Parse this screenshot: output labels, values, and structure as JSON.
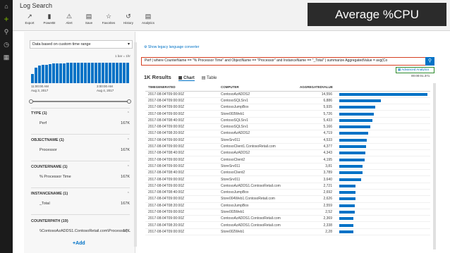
{
  "app": {
    "title": "Log Search"
  },
  "banner": {
    "text": "Average %CPU"
  },
  "leftbar": {
    "icons": [
      "home-icon",
      "plus-icon",
      "search-icon",
      "clock-icon",
      "analytics-icon"
    ]
  },
  "toolbar": {
    "items": [
      {
        "label": "Export",
        "icon": "export-icon"
      },
      {
        "label": "PowerBI",
        "icon": "powerbi-icon"
      },
      {
        "label": "Alert",
        "icon": "bell-icon"
      },
      {
        "label": "Save",
        "icon": "save-icon"
      },
      {
        "label": "Favorites",
        "icon": "star-icon"
      },
      {
        "label": "History",
        "icon": "history-icon"
      },
      {
        "label": "Analytics",
        "icon": "analytics-icon"
      }
    ]
  },
  "filters": {
    "time_range": "Data based on custom time range",
    "histogram": {
      "interval": "1 bar = 1hr",
      "values": [
        0.45,
        0.75,
        0.83,
        0.86,
        0.88,
        0.9,
        0.92,
        0.93,
        0.94,
        0.95,
        0.96,
        0.97,
        0.97,
        0.97,
        0.97,
        0.97,
        0.97,
        0.97,
        0.97,
        0.97,
        0.97,
        0.97,
        0.97,
        0.97,
        0.97,
        0.98,
        0.98,
        0.98
      ],
      "start_time": "11:00:00 AM",
      "start_date": "Aug 3, 2017",
      "end_time": "3:00:00 AM",
      "end_date": "Aug 4, 2017"
    },
    "facets": [
      {
        "header": "TYPE (1)",
        "value": "Perf",
        "count": "167K"
      },
      {
        "header": "OBJECTNAME (1)",
        "value": "Processor",
        "count": "167K"
      },
      {
        "header": "COUNTERNAME (1)",
        "value": "% Processor Time",
        "count": "167K"
      },
      {
        "header": "INSTANCENAME (1)",
        "value": "_Total",
        "count": "167K"
      },
      {
        "header": "COUNTERPATH (19)",
        "value": "\\\\ContosoAzADDS1.ContosoRetail.com\\Processor(...",
        "count": "17K"
      }
    ],
    "add_label": "+Add"
  },
  "query": {
    "legacy_link": "Show legacy language converter",
    "text": "Perf | where CounterName == \"% Processor Time\" and ObjectName == \"Processor\" and InstanceName == \"_Total\" | summarize AggregatedValue = avg(Co",
    "advanced_analytics": "Advanced Analytics"
  },
  "results": {
    "tabs": [
      {
        "label": "1K Results"
      },
      {
        "label": "Chart",
        "icon": "chart-icon"
      },
      {
        "label": "Table",
        "icon": "table-icon"
      }
    ],
    "elapsed": "00:00:01.371",
    "columns": [
      "TIMEGENERATED",
      "COMPUTER",
      "AGGREGATEDVALUE"
    ],
    "max_value": 14.556,
    "rows": [
      {
        "time": "2017-08-04T09:00:00Z",
        "computer": "ContosoAzADDS2",
        "value_text": "14,556",
        "value": 14.556
      },
      {
        "time": "2017-08-04T09:00:00Z",
        "computer": "ContosoSQLSrv1",
        "value_text": "6,886",
        "value": 6.886
      },
      {
        "time": "2017-08-04T09:00:00Z",
        "computer": "ContosoJumpBox",
        "value_text": "5,935",
        "value": 5.935
      },
      {
        "time": "2017-08-04T09:00:00Z",
        "computer": "Store003Web1",
        "value_text": "5,726",
        "value": 5.726
      },
      {
        "time": "2017-08-04T08:40:00Z",
        "computer": "ContosoSQLSrv1",
        "value_text": "5,433",
        "value": 5.433
      },
      {
        "time": "2017-08-04T09:00:00Z",
        "computer": "ContosoSQLSrv1",
        "value_text": "5,166",
        "value": 5.166
      },
      {
        "time": "2017-08-04T08:20:00Z",
        "computer": "ContosoAzADDS2",
        "value_text": "4,719",
        "value": 4.719
      },
      {
        "time": "2017-08-04T09:00:00Z",
        "computer": "StoreSrv011",
        "value_text": "4,533",
        "value": 4.533
      },
      {
        "time": "2017-08-04T09:00:00Z",
        "computer": "ContosoClient1.ContosoRetail.com",
        "value_text": "4,377",
        "value": 4.377
      },
      {
        "time": "2017-08-04T08:40:00Z",
        "computer": "ContosoAzADDS2",
        "value_text": "4,343",
        "value": 4.343
      },
      {
        "time": "2017-08-04T09:00:00Z",
        "computer": "ContosoClient2",
        "value_text": "4,195",
        "value": 4.195
      },
      {
        "time": "2017-08-04T09:00:00Z",
        "computer": "StoreSrv011",
        "value_text": "3,81",
        "value": 3.81
      },
      {
        "time": "2017-08-04T08:40:00Z",
        "computer": "ContosoClient2",
        "value_text": "3,789",
        "value": 3.789
      },
      {
        "time": "2017-08-04T09:00:00Z",
        "computer": "StoreSrv011",
        "value_text": "3,640",
        "value": 3.64
      },
      {
        "time": "2017-08-04T09:00:00Z",
        "computer": "ContosoAzADDS1.ContosoRetail.com",
        "value_text": "2,721",
        "value": 2.721
      },
      {
        "time": "2017-08-04T08:40:00Z",
        "computer": "ContosoJumpBox",
        "value_text": "2,692",
        "value": 2.692
      },
      {
        "time": "2017-08-04T09:00:00Z",
        "computer": "Store004Web1.ContosoRetail.com",
        "value_text": "2,626",
        "value": 2.626
      },
      {
        "time": "2017-08-04T08:20:00Z",
        "computer": "ContosoJumpBox",
        "value_text": "2,559",
        "value": 2.559
      },
      {
        "time": "2017-08-04T09:00:00Z",
        "computer": "Store003Web1",
        "value_text": "2,52",
        "value": 2.52
      },
      {
        "time": "2017-08-04T09:00:00Z",
        "computer": "ContosoAzADDS1.ContosoRetail.com",
        "value_text": "2,369",
        "value": 2.369
      },
      {
        "time": "2017-08-04T08:20:00Z",
        "computer": "ContosoAzADDS1.ContosoRetail.com",
        "value_text": "2,338",
        "value": 2.338
      },
      {
        "time": "2017-08-04T09:00:00Z",
        "computer": "Store002Web1",
        "value_text": "2,28",
        "value": 2.28
      }
    ]
  }
}
